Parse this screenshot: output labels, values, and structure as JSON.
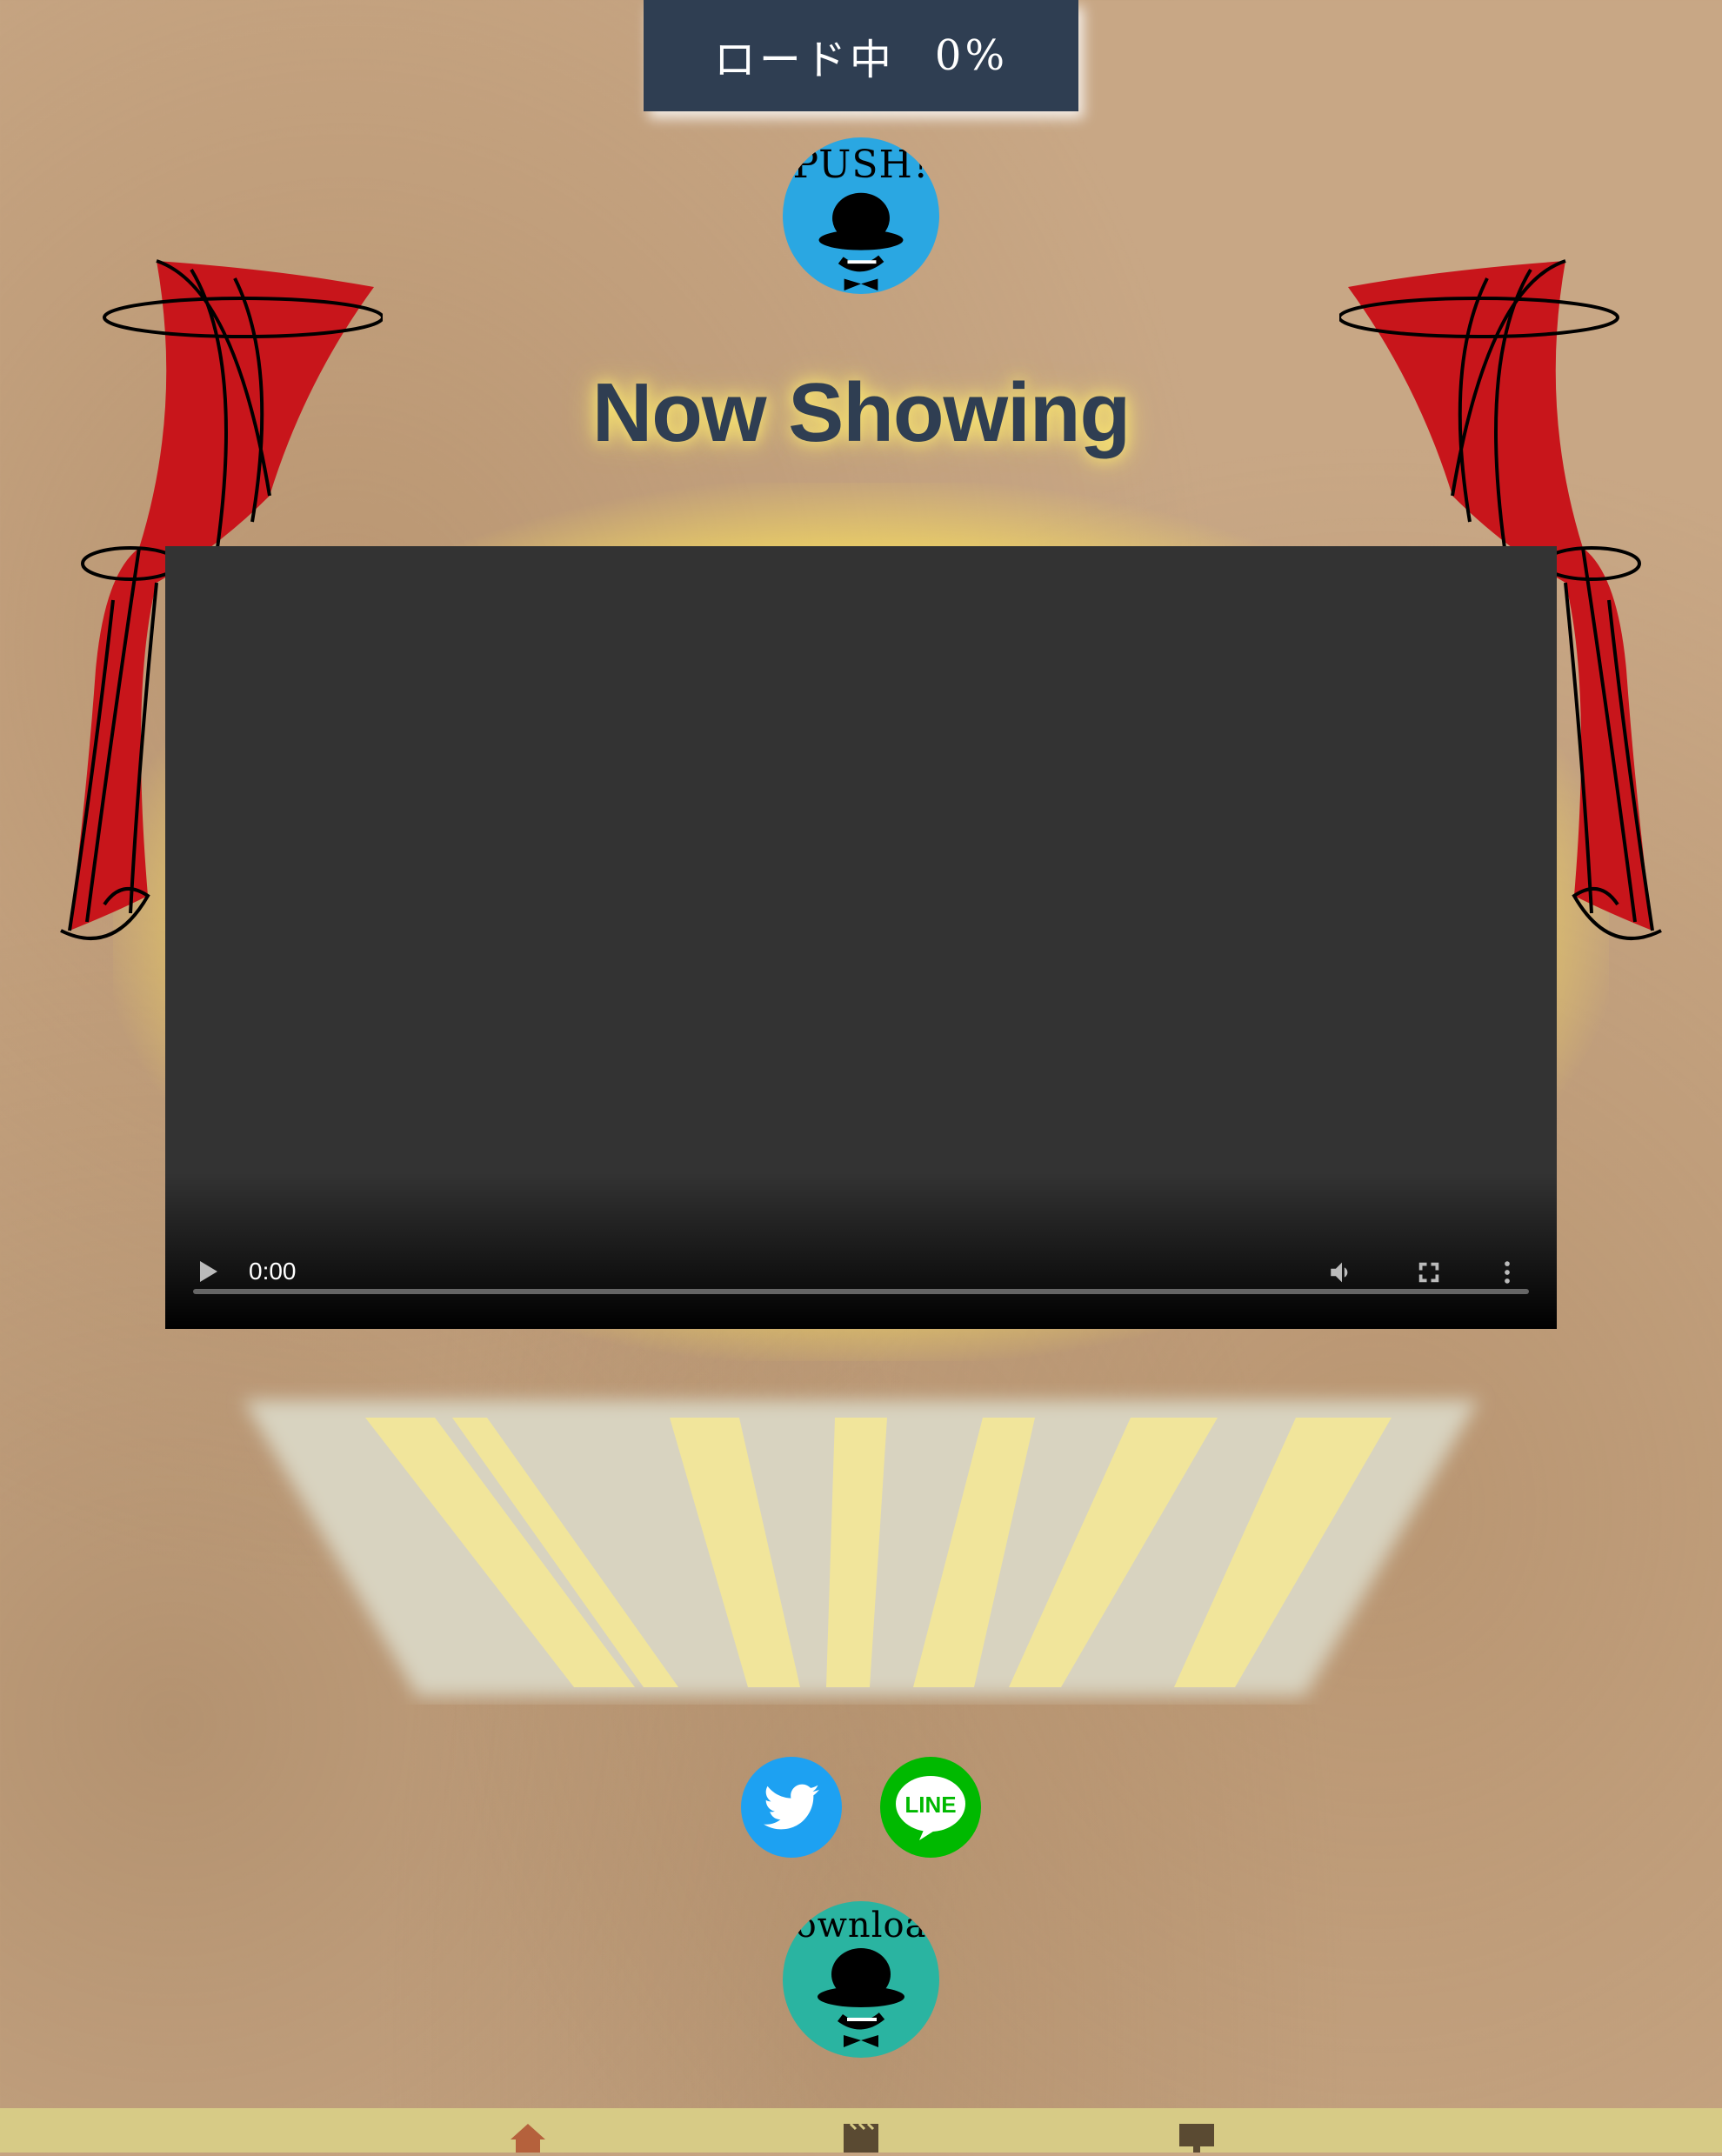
{
  "loading": {
    "label": "ロード中",
    "percent": "0%"
  },
  "push_button": {
    "label": "PUSH!"
  },
  "title": "Now Showing",
  "video": {
    "time": "0:00"
  },
  "share": {
    "twitter": "twitter",
    "line_label": "LINE"
  },
  "download_button": {
    "label": "download"
  },
  "nav": {
    "items": [
      "home",
      "movie",
      "screen"
    ],
    "active": "home"
  },
  "colors": {
    "background": "#c8a785",
    "loading_box": "#2f3e52",
    "title": "#2f3e52",
    "push_button": "#2aa7e2",
    "download_button": "#2ab4a1",
    "twitter": "#1da1f2",
    "line": "#00b900",
    "curtain": "#c8151b",
    "nav_bar": "#d7cb86",
    "nav_active": "#b5613c"
  }
}
